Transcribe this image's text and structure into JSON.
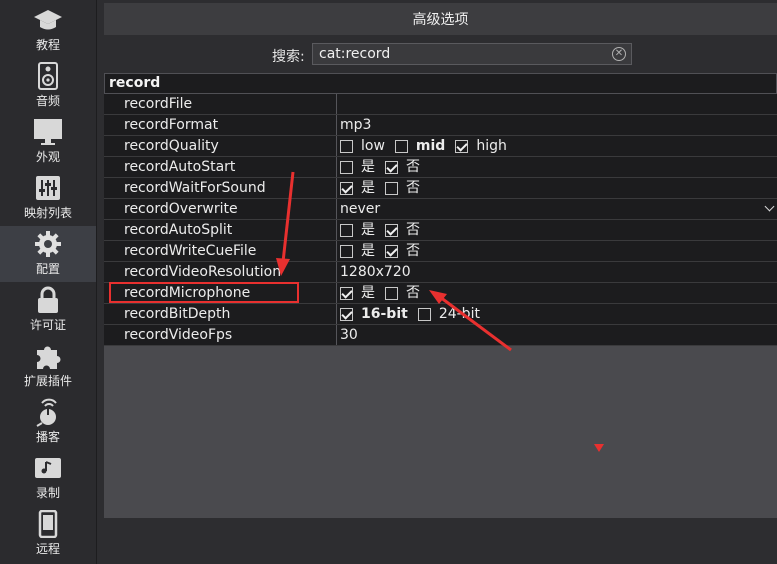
{
  "sidebar": {
    "items": [
      {
        "label": "教程",
        "icon": "graduation-cap-icon"
      },
      {
        "label": "音频",
        "icon": "speaker-icon"
      },
      {
        "label": "外观",
        "icon": "monitor-icon"
      },
      {
        "label": "映射列表",
        "icon": "sliders-icon"
      },
      {
        "label": "配置",
        "icon": "gear-icon",
        "active": true
      },
      {
        "label": "许可证",
        "icon": "lock-icon"
      },
      {
        "label": "扩展插件",
        "icon": "puzzle-icon"
      },
      {
        "label": "播客",
        "icon": "podcast-icon"
      },
      {
        "label": "录制",
        "icon": "music-note-icon"
      },
      {
        "label": "远程",
        "icon": "phone-icon"
      }
    ]
  },
  "header": {
    "title": "高级选项"
  },
  "search": {
    "label": "搜索:",
    "value": "cat:record",
    "clear_icon": "clear-circle-icon"
  },
  "table": {
    "group": "record",
    "rows": {
      "recordFile": {
        "key": "recordFile",
        "value": ""
      },
      "recordFormat": {
        "key": "recordFormat",
        "value": "mp3"
      },
      "recordQuality": {
        "key": "recordQuality",
        "options": [
          {
            "label": "low",
            "checked": false
          },
          {
            "label": "mid",
            "checked": false
          },
          {
            "label": "high",
            "checked": true
          }
        ]
      },
      "recordAutoStart": {
        "key": "recordAutoStart",
        "options": [
          {
            "label": "是",
            "checked": false
          },
          {
            "label": "否",
            "checked": true
          }
        ]
      },
      "recordWaitForSound": {
        "key": "recordWaitForSound",
        "options": [
          {
            "label": "是",
            "checked": true
          },
          {
            "label": "否",
            "checked": false
          }
        ]
      },
      "recordOverwrite": {
        "key": "recordOverwrite",
        "value": "never"
      },
      "recordAutoSplit": {
        "key": "recordAutoSplit",
        "options": [
          {
            "label": "是",
            "checked": false
          },
          {
            "label": "否",
            "checked": true
          }
        ]
      },
      "recordWriteCueFile": {
        "key": "recordWriteCueFile",
        "options": [
          {
            "label": "是",
            "checked": false
          },
          {
            "label": "否",
            "checked": true
          }
        ]
      },
      "recordVideoResolution": {
        "key": "recordVideoResolution",
        "value": "1280x720"
      },
      "recordMicrophone": {
        "key": "recordMicrophone",
        "options": [
          {
            "label": "是",
            "checked": true
          },
          {
            "label": "否",
            "checked": false
          }
        ]
      },
      "recordBitDepth": {
        "key": "recordBitDepth",
        "options": [
          {
            "label": "16-bit",
            "checked": true
          },
          {
            "label": "24-bit",
            "checked": false
          }
        ]
      },
      "recordVideoFps": {
        "key": "recordVideoFps",
        "value": "30"
      }
    }
  },
  "colors": {
    "annotation": "#e8302f",
    "row_bg": "#1c1c1e",
    "panel_bg": "#4a4a4e"
  }
}
